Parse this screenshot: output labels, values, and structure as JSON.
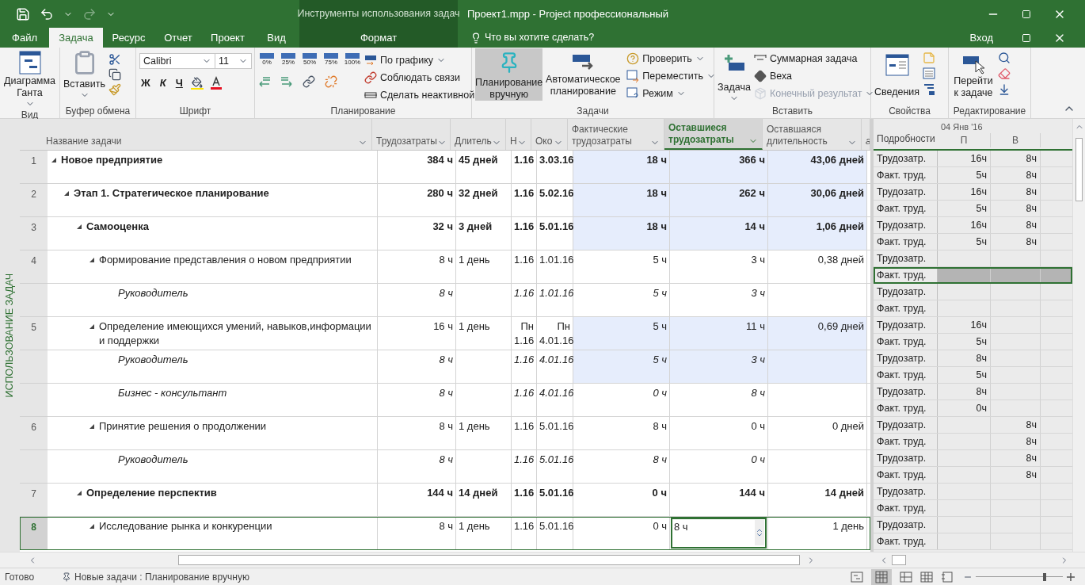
{
  "title_bar": {
    "contextual_title": "Инструменты использования задач",
    "title": "Проект1.mpp - Project профессиональный"
  },
  "tabs": [
    {
      "label": "Файл",
      "selected": false
    },
    {
      "label": "Задача",
      "selected": true
    },
    {
      "label": "Ресурс",
      "selected": false
    },
    {
      "label": "Отчет",
      "selected": false
    },
    {
      "label": "Проект",
      "selected": false
    },
    {
      "label": "Вид",
      "selected": false
    },
    {
      "label": "Формат",
      "selected": false
    }
  ],
  "tell_me": {
    "placeholder": "Что вы хотите сделать?"
  },
  "sign_in": "Вход",
  "ribbon": {
    "view": {
      "label": "Вид",
      "gantt": "Диаграмма Ганта"
    },
    "clipboard": {
      "label": "Буфер обмена",
      "paste": "Вставить"
    },
    "font": {
      "label": "Шрифт",
      "family": "Calibri",
      "size": "11",
      "bold": "Ж",
      "italic": "К",
      "underline": "Ч"
    },
    "schedule": {
      "label": "Планирование",
      "percents": [
        "0%",
        "25%",
        "50%",
        "75%",
        "100%"
      ],
      "on_track": "По графику",
      "respect_links": "Соблюдать связи",
      "inactivate": "Сделать неактивной"
    },
    "tasks": {
      "label": "Задачи",
      "manual": {
        "label": "Планирование вручную",
        "selected": true
      },
      "auto": {
        "label": "Автоматическое планирование",
        "selected": false
      },
      "inspect": "Проверить",
      "move": "Переместить",
      "mode": "Режим"
    },
    "insert": {
      "label": "Вставить",
      "task": "Задача",
      "summary": "Суммарная задача",
      "milestone": "Веха",
      "deliverable": {
        "label": "Конечный результат",
        "disabled": true
      }
    },
    "properties": {
      "label": "Свойства",
      "information": "Сведения"
    },
    "editing": {
      "label": "Редактирование",
      "scroll_to_task": "Перейти к задаче"
    }
  },
  "side_label": "ИСПОЛЬЗОВАНИЕ ЗАДАЧ",
  "table": {
    "columns": [
      {
        "label": "Название задачи",
        "selected": false
      },
      {
        "label": "Трудозатраты",
        "selected": false
      },
      {
        "label": "Длитель",
        "selected": false
      },
      {
        "label": "Н",
        "selected": false
      },
      {
        "label": "Око",
        "selected": false
      },
      {
        "label": "Фактические трудозатраты",
        "selected": false
      },
      {
        "label": "Оставшиеся трудозатраты",
        "selected": true
      },
      {
        "label": "Оставшаяся длительность",
        "selected": false
      },
      {
        "label": "а",
        "selected": false
      }
    ],
    "rows": [
      {
        "id": "1",
        "kind": "summary",
        "name": "Новое предприятие",
        "work": "384 ч",
        "duration": "45 дней",
        "start": "1.16",
        "finish": "3.03.16",
        "actual_work": "18 ч",
        "remaining_work": "366 ч",
        "remaining_duration": "43,06 дней",
        "expanded": true,
        "highlighted": true,
        "selected": false,
        "details": [
          {
            "label": "Трудозатр.",
            "day_1": "16ч",
            "day_2": "8ч",
            "selected": false
          },
          {
            "label": "Факт. труд.",
            "day_1": "5ч",
            "day_2": "8ч",
            "selected": false
          }
        ],
        "children": [
          {
            "id": "2",
            "kind": "summary",
            "name": "Этап 1. Стратегическое планирование",
            "work": "280 ч",
            "duration": "32 дней",
            "start": "1.16",
            "finish": "5.02.16",
            "actual_work": "18 ч",
            "remaining_work": "262 ч",
            "remaining_duration": "30,06 дней",
            "expanded": true,
            "highlighted": true,
            "selected": false,
            "details": [
              {
                "label": "Трудозатр.",
                "day_1": "16ч",
                "day_2": "8ч",
                "selected": false
              },
              {
                "label": "Факт. труд.",
                "day_1": "5ч",
                "day_2": "8ч",
                "selected": false
              }
            ],
            "children": [
              {
                "id": "3",
                "kind": "summary",
                "name": "Самооценка",
                "work": "32 ч",
                "duration": "3 дней",
                "start": "1.16",
                "finish": "5.01.16",
                "actual_work": "18 ч",
                "remaining_work": "14 ч",
                "remaining_duration": "1,06 дней",
                "expanded": true,
                "highlighted": true,
                "selected": false,
                "details": [
                  {
                    "label": "Трудозатр.",
                    "day_1": "16ч",
                    "day_2": "8ч",
                    "selected": false
                  },
                  {
                    "label": "Факт. труд.",
                    "day_1": "5ч",
                    "day_2": "8ч",
                    "selected": false
                  }
                ],
                "children": [
                  {
                    "id": "4",
                    "kind": "task",
                    "name": "Формирование представления о новом предприятии",
                    "work": "8 ч",
                    "duration": "1 день",
                    "start": "1.16",
                    "finish": "1.01.16",
                    "actual_work": "5 ч",
                    "remaining_work": "3 ч",
                    "remaining_duration": "0,38 дней",
                    "expanded": true,
                    "highlighted": false,
                    "selected": false,
                    "details": [
                      {
                        "label": "Трудозатр.",
                        "selected": false
                      },
                      {
                        "label": "Факт. труд.",
                        "selected": true
                      }
                    ],
                    "children": [
                      {
                        "kind": "assignment",
                        "name": "Руководитель",
                        "work": "8 ч",
                        "start": "1.16",
                        "finish": "1.01.16",
                        "actual_work": "5 ч",
                        "remaining_work": "3 ч",
                        "highlighted": false,
                        "selected": false,
                        "details": [
                          {
                            "label": "Трудозатр.",
                            "selected": false
                          },
                          {
                            "label": "Факт. труд.",
                            "selected": false
                          }
                        ]
                      }
                    ]
                  },
                  {
                    "id": "5",
                    "kind": "task",
                    "name": "Определение имеющихся умений, навыков,информации и поддержки",
                    "work": "16 ч",
                    "duration": "1 день",
                    "start": "Пн 1.16",
                    "finish": "Пн 4.01.16",
                    "actual_work": "5 ч",
                    "remaining_work": "11 ч",
                    "remaining_duration": "0,69 дней",
                    "expanded": true,
                    "highlighted": true,
                    "selected": false,
                    "details": [
                      {
                        "label": "Трудозатр.",
                        "day_1": "16ч",
                        "selected": false
                      },
                      {
                        "label": "Факт. труд.",
                        "day_1": "5ч",
                        "selected": false
                      }
                    ],
                    "children": [
                      {
                        "kind": "assignment",
                        "name": "Руководитель",
                        "work": "8 ч",
                        "start": "1.16",
                        "finish": "4.01.16",
                        "actual_work": "5 ч",
                        "remaining_work": "3 ч",
                        "highlighted": true,
                        "selected": false,
                        "details": [
                          {
                            "label": "Трудозатр.",
                            "day_1": "8ч",
                            "selected": false
                          },
                          {
                            "label": "Факт. труд.",
                            "day_1": "5ч",
                            "selected": false
                          }
                        ]
                      },
                      {
                        "kind": "assignment",
                        "name": "Бизнес - консультант",
                        "work": "8 ч",
                        "start": "1.16",
                        "finish": "4.01.16",
                        "actual_work": "0 ч",
                        "remaining_work": "8 ч",
                        "highlighted": false,
                        "selected": false,
                        "details": [
                          {
                            "label": "Трудозатр.",
                            "day_1": "8ч",
                            "selected": false
                          },
                          {
                            "label": "Факт. труд.",
                            "day_1": "0ч",
                            "selected": false
                          }
                        ]
                      }
                    ]
                  },
                  {
                    "id": "6",
                    "kind": "task",
                    "name": "Принятие решения о продолжении",
                    "work": "8 ч",
                    "duration": "1 день",
                    "start": "1.16",
                    "finish": "5.01.16",
                    "actual_work": "8 ч",
                    "remaining_work": "0 ч",
                    "remaining_duration": "0 дней",
                    "expanded": true,
                    "highlighted": false,
                    "selected": false,
                    "details": [
                      {
                        "label": "Трудозатр.",
                        "day_2": "8ч",
                        "selected": false
                      },
                      {
                        "label": "Факт. труд.",
                        "day_2": "8ч",
                        "selected": false
                      }
                    ],
                    "children": [
                      {
                        "kind": "assignment",
                        "name": "Руководитель",
                        "work": "8 ч",
                        "start": "1.16",
                        "finish": "5.01.16",
                        "actual_work": "8 ч",
                        "remaining_work": "0 ч",
                        "highlighted": false,
                        "selected": false,
                        "details": [
                          {
                            "label": "Трудозатр.",
                            "day_2": "8ч",
                            "selected": false
                          },
                          {
                            "label": "Факт. труд.",
                            "day_2": "8ч",
                            "selected": false
                          }
                        ]
                      }
                    ]
                  }
                ]
              },
              {
                "id": "7",
                "kind": "summary",
                "name": "Определение перспектив",
                "work": "144 ч",
                "duration": "14 дней",
                "start": "1.16",
                "finish": "5.01.16",
                "actual_work": "0 ч",
                "remaining_work": "144 ч",
                "remaining_duration": "14 дней",
                "expanded": true,
                "highlighted": false,
                "selected": false,
                "details": [
                  {
                    "label": "Трудозатр.",
                    "selected": false
                  },
                  {
                    "label": "Факт. труд.",
                    "selected": false
                  }
                ],
                "children": [
                  {
                    "id": "8",
                    "kind": "task",
                    "name": "Исследование рынка и конкуренции",
                    "work": "8 ч",
                    "duration": "1 день",
                    "start": "1.16",
                    "finish": "5.01.16",
                    "actual_work": "0 ч",
                    "remaining_work": "8 ч",
                    "remaining_duration": "1 день",
                    "expanded": true,
                    "highlighted": false,
                    "selected": true,
                    "details": [
                      {
                        "label": "Трудозатр.",
                        "selected": false
                      },
                      {
                        "label": "Факт. труд.",
                        "selected": false
                      }
                    ]
                  }
                ]
              }
            ]
          }
        ]
      }
    ]
  },
  "timescale": {
    "details_header": "Подробности",
    "date": "04 Янв '16",
    "days": [
      "П",
      "В"
    ]
  },
  "status_bar": {
    "ready": "Готово",
    "new_tasks": "Новые задачи : Планирование вручную",
    "zoom": {
      "level": 0.8
    }
  }
}
